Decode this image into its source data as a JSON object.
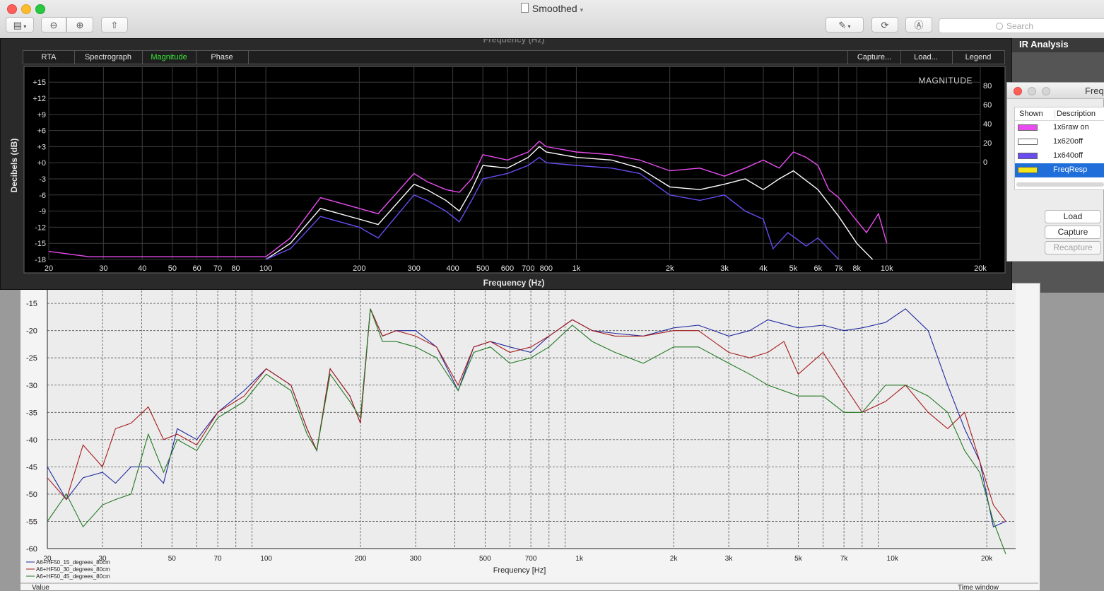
{
  "window": {
    "title": "Smoothed",
    "search_placeholder": "Search"
  },
  "sidebar": {
    "title": "IR Analysis"
  },
  "rta": {
    "tabs": [
      "RTA",
      "Spectrograph",
      "Magnitude",
      "Phase"
    ],
    "active_tab": "Magnitude",
    "right_tabs": [
      "Capture...",
      "Load...",
      "Legend"
    ]
  },
  "legend_window": {
    "title": "Freq",
    "col_shown": "Shown",
    "col_description": "Description",
    "rows": [
      {
        "label": "1x6raw on",
        "color": "#e84cf0"
      },
      {
        "label": "1x620off",
        "color": "#ffffff"
      },
      {
        "label": "1x640off",
        "color": "#6a4cf0"
      },
      {
        "label": "FreqResp",
        "color": "#f2e51a"
      }
    ],
    "buttons": {
      "load": "Load",
      "capture": "Capture",
      "recapture": "Recapture"
    }
  },
  "chart_data": [
    {
      "type": "line",
      "title": "MAGNITUDE",
      "xlabel": "Frequency (Hz)",
      "ylabel": "Decibels (dB)",
      "xscale": "log",
      "xlim": [
        20,
        20000
      ],
      "ylim": [
        -18,
        17
      ],
      "x_ticks": [
        20,
        30,
        40,
        50,
        60,
        70,
        80,
        100,
        200,
        300,
        400,
        500,
        600,
        700,
        800,
        1000,
        2000,
        3000,
        4000,
        5000,
        6000,
        7000,
        8000,
        10000,
        20000
      ],
      "x_tick_labels": [
        "20",
        "30",
        "40",
        "50",
        "60",
        "70",
        "80",
        "100",
        "200",
        "300",
        "400",
        "500",
        "600",
        "700",
        "800",
        "1k",
        "2k",
        "3k",
        "4k",
        "5k",
        "6k",
        "7k",
        "8k",
        "10k",
        "20k"
      ],
      "y_ticks": [
        15,
        12,
        9,
        6,
        3,
        0,
        -3,
        -6,
        -9,
        -12,
        -15,
        -18
      ],
      "y_tick_labels": [
        "+15",
        "+12",
        "+9",
        "+6",
        "+3",
        "+0",
        "-3",
        "-6",
        "-9",
        "-12",
        "-15",
        "-18"
      ],
      "right_axis_labels": [
        "80",
        "60",
        "40",
        "20",
        "0"
      ],
      "grid": true,
      "series": [
        {
          "name": "1x6raw on",
          "color": "#e84cf0",
          "x": [
            20,
            27,
            100,
            120,
            150,
            200,
            230,
            300,
            330,
            380,
            420,
            460,
            500,
            600,
            700,
            760,
            800,
            1000,
            1300,
            1600,
            2000,
            2500,
            3000,
            3500,
            4000,
            4500,
            5000,
            5500,
            6000,
            6500,
            7000,
            7800,
            8600,
            9400,
            10000
          ],
          "y": [
            -16.5,
            -17.5,
            -17.5,
            -14,
            -6.5,
            -8.5,
            -9.5,
            -2,
            -3.5,
            -5,
            -5.5,
            -3,
            1.5,
            0.5,
            2,
            4,
            3,
            2,
            1.5,
            0.5,
            -1.5,
            -1,
            -2.5,
            -1,
            0.5,
            -1,
            2,
            1,
            -0.5,
            -5,
            -6.5,
            -10,
            -13,
            -9.5,
            -15
          ]
        },
        {
          "name": "1x620off",
          "color": "#ffffff",
          "x": [
            100,
            120,
            150,
            200,
            230,
            300,
            330,
            380,
            420,
            460,
            500,
            600,
            700,
            760,
            800,
            1000,
            1300,
            1600,
            2000,
            2500,
            3000,
            3500,
            4000,
            4500,
            5000,
            6000,
            7000,
            8000,
            9000
          ],
          "y": [
            -18,
            -15,
            -8.5,
            -10.5,
            -11.5,
            -4,
            -5,
            -7,
            -9,
            -5,
            -0.5,
            -1,
            1,
            3,
            2,
            1,
            0.5,
            -1,
            -4.5,
            -5,
            -4,
            -3,
            -5,
            -3,
            -1.5,
            -5,
            -10,
            -15,
            -18
          ]
        },
        {
          "name": "1x640off",
          "color": "#6a4cf0",
          "x": [
            100,
            120,
            150,
            200,
            230,
            300,
            330,
            380,
            420,
            460,
            500,
            600,
            700,
            760,
            800,
            1000,
            1300,
            1600,
            2000,
            2500,
            3000,
            3500,
            4000,
            4300,
            4800,
            5500,
            6000,
            7000
          ],
          "y": [
            -18,
            -16,
            -10,
            -12,
            -14,
            -6,
            -7,
            -9,
            -11,
            -7,
            -3,
            -2,
            -0.5,
            1,
            0,
            -0.5,
            -1,
            -2,
            -6,
            -7,
            -6,
            -9,
            -10.5,
            -16,
            -13,
            -15.5,
            -14,
            -18
          ]
        }
      ]
    },
    {
      "type": "line",
      "xlabel": "Frequency [Hz]",
      "xscale": "log",
      "xlim": [
        20,
        23000
      ],
      "ylim": [
        -60,
        -12
      ],
      "x_ticks": [
        20,
        30,
        50,
        70,
        100,
        200,
        300,
        500,
        700,
        1000,
        2000,
        3000,
        5000,
        7000,
        10000,
        20000
      ],
      "x_tick_labels": [
        "20",
        "30",
        "50",
        "70",
        "100",
        "200",
        "300",
        "500",
        "700",
        "1k",
        "2k",
        "3k",
        "5k",
        "7k",
        "10k",
        "20k"
      ],
      "y_ticks": [
        -15,
        -20,
        -25,
        -30,
        -35,
        -40,
        -45,
        -50,
        -55,
        -60
      ],
      "y_tick_labels": [
        "-15",
        "-20",
        "-25",
        "-30",
        "-35",
        "-40",
        "-45",
        "-50",
        "-55",
        "-60"
      ],
      "grid": true,
      "footer_left": "Value",
      "footer_right": "Time window",
      "series": [
        {
          "name": "A6+HF50_15_degrees_80cm",
          "color": "#1f2a9e",
          "x": [
            20,
            23,
            26,
            30,
            33,
            37,
            42,
            47,
            52,
            60,
            70,
            85,
            100,
            120,
            135,
            145,
            160,
            185,
            200,
            215,
            235,
            260,
            300,
            350,
            410,
            460,
            520,
            600,
            700,
            800,
            950,
            1100,
            1300,
            1600,
            2000,
            2400,
            3000,
            3500,
            4000,
            5000,
            6000,
            7000,
            8000,
            9500,
            11000,
            13000,
            15000,
            17000,
            19000,
            21000,
            23000
          ],
          "y": [
            -45,
            -51,
            -47,
            -46,
            -48,
            -45,
            -45,
            -48,
            -38,
            -40,
            -35,
            -31,
            -27,
            -30,
            -38,
            -42,
            -27,
            -32,
            -37,
            -16,
            -21,
            -20,
            -20,
            -23,
            -31,
            -23,
            -22,
            -23,
            -24,
            -21,
            -18,
            -20,
            -20.5,
            -21,
            -19.5,
            -19,
            -21,
            -20,
            -18,
            -19.5,
            -19,
            -20,
            -19.5,
            -18.5,
            -16,
            -20,
            -30,
            -38,
            -44,
            -56,
            -55
          ]
        },
        {
          "name": "A6+HF50_30_degrees_80cm",
          "color": "#a61c1c",
          "x": [
            20,
            23,
            26,
            30,
            33,
            37,
            42,
            47,
            52,
            60,
            70,
            85,
            100,
            120,
            135,
            145,
            160,
            185,
            200,
            215,
            235,
            260,
            300,
            350,
            410,
            460,
            520,
            600,
            700,
            800,
            950,
            1100,
            1300,
            1600,
            2000,
            2400,
            3000,
            3500,
            4000,
            4500,
            5000,
            6000,
            7000,
            8000,
            9500,
            11000,
            13000,
            15000,
            17000,
            19000,
            21000,
            23000
          ],
          "y": [
            -47,
            -51,
            -41,
            -45,
            -38,
            -37,
            -34,
            -40,
            -39,
            -41,
            -35,
            -32,
            -27,
            -30,
            -38,
            -42,
            -27,
            -32,
            -37,
            -16,
            -21,
            -20,
            -21,
            -23,
            -30,
            -23,
            -22,
            -24,
            -23,
            -21,
            -18,
            -20,
            -21,
            -21,
            -20,
            -20,
            -24,
            -25,
            -24,
            -22,
            -28,
            -24,
            -30,
            -35,
            -33,
            -30,
            -35,
            -38,
            -35,
            -44,
            -52,
            -55
          ]
        },
        {
          "name": "A6+HF50_45_degrees_80cm",
          "color": "#237a23",
          "x": [
            20,
            23,
            26,
            30,
            33,
            37,
            42,
            47,
            52,
            60,
            70,
            85,
            100,
            120,
            135,
            145,
            160,
            185,
            200,
            215,
            235,
            260,
            300,
            350,
            410,
            460,
            520,
            600,
            700,
            800,
            950,
            1100,
            1300,
            1600,
            2000,
            2400,
            3000,
            3500,
            4000,
            5000,
            6000,
            7000,
            8000,
            9500,
            11000,
            13000,
            15000,
            17000,
            19000,
            21000,
            23000
          ],
          "y": [
            -55,
            -50,
            -56,
            -52,
            -51,
            -50,
            -39,
            -46,
            -40,
            -42,
            -36,
            -33,
            -28,
            -31,
            -39,
            -42,
            -28,
            -33,
            -36,
            -16,
            -22,
            -22,
            -23,
            -25,
            -31,
            -24,
            -23,
            -26,
            -25,
            -23,
            -19,
            -22,
            -24,
            -26,
            -23,
            -23,
            -26,
            -28,
            -30,
            -32,
            -32,
            -35,
            -35,
            -30,
            -30,
            -32,
            -35,
            -42,
            -46,
            -55,
            -61
          ]
        }
      ]
    }
  ]
}
